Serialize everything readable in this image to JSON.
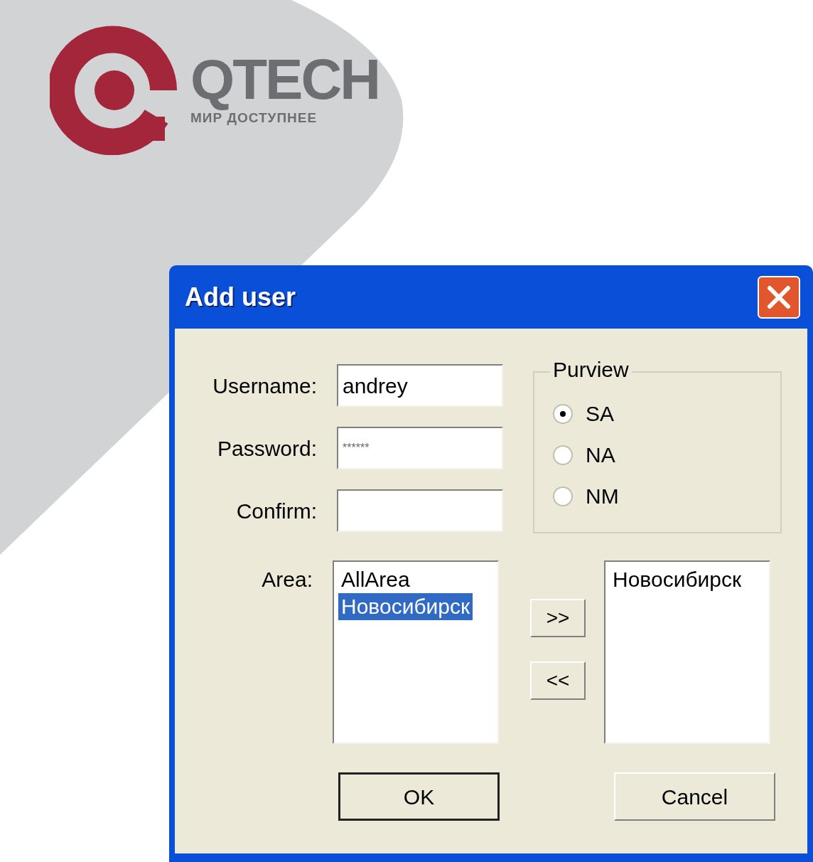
{
  "logo": {
    "name": "QTECH",
    "tagline": "МИР ДОСТУПНЕЕ"
  },
  "dialog": {
    "title": "Add user",
    "fields": [
      {
        "label": "Username:",
        "value": "andrey",
        "kind": "text"
      },
      {
        "label": "Password:",
        "value": "******",
        "kind": "password"
      },
      {
        "label": "Confirm:"
      }
    ],
    "purview": {
      "title": "Purview",
      "options": [
        {
          "label": "SA",
          "selected": true
        },
        {
          "label": "NA",
          "selected": false
        },
        {
          "label": "NM",
          "selected": false
        }
      ]
    },
    "area": {
      "label": "Area:",
      "available": [
        {
          "label": "AllArea",
          "selected": false
        },
        {
          "label": "Новосибирск",
          "selected": true
        }
      ],
      "assigned": [
        {
          "label": "Новосибирск",
          "selected": false
        }
      ]
    },
    "move_buttons": [
      ">>",
      "<<"
    ],
    "buttons": [
      {
        "label": "OK",
        "default": true
      },
      {
        "label": "Cancel",
        "default": false
      }
    ]
  }
}
